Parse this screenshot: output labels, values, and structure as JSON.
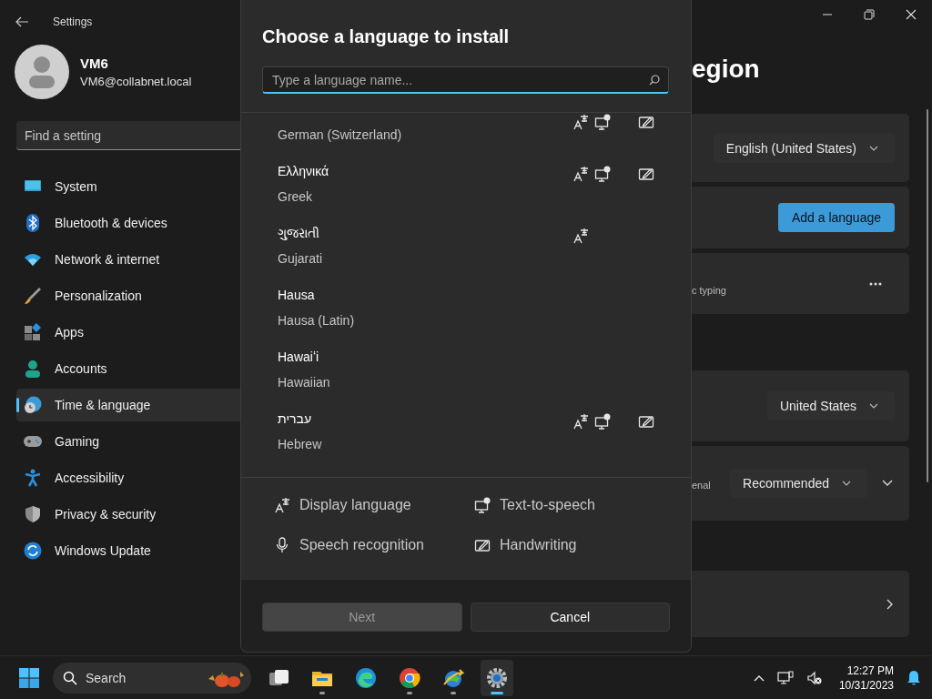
{
  "window": {
    "title": "Settings"
  },
  "sidebar": {
    "user": {
      "name": "VM6",
      "email": "VM6@collabnet.local"
    },
    "search": {
      "placeholder": "Find a setting"
    },
    "items": [
      {
        "label": "System",
        "kind": "system",
        "selected": false
      },
      {
        "label": "Bluetooth & devices",
        "kind": "bluetooth",
        "selected": false
      },
      {
        "label": "Network & internet",
        "kind": "network",
        "selected": false
      },
      {
        "label": "Personalization",
        "kind": "brush",
        "selected": false
      },
      {
        "label": "Apps",
        "kind": "apps",
        "selected": false
      },
      {
        "label": "Accounts",
        "kind": "accounts",
        "selected": false
      },
      {
        "label": "Time & language",
        "kind": "time",
        "selected": true
      },
      {
        "label": "Gaming",
        "kind": "gaming",
        "selected": false
      },
      {
        "label": "Accessibility",
        "kind": "accessibility",
        "selected": false
      },
      {
        "label": "Privacy & security",
        "kind": "privacy",
        "selected": false
      },
      {
        "label": "Windows Update",
        "kind": "update",
        "selected": false
      }
    ]
  },
  "page": {
    "heading": "egion",
    "cards": [
      {
        "kind": "dropdown",
        "value": "English (United States)",
        "expandable": false
      },
      {
        "kind": "button",
        "label": "Add a language"
      },
      {
        "kind": "more",
        "text": "c typing"
      },
      {
        "kind": "dropdown",
        "value": "United States",
        "expandable": false
      },
      {
        "kind": "dropdown",
        "text": "enal",
        "value": "Recommended",
        "expandable": true
      },
      {
        "kind": "link"
      }
    ]
  },
  "dialog": {
    "title": "Choose a language to install",
    "search": {
      "placeholder": "Type a language name..."
    },
    "languages": [
      {
        "english": "German (Switzerland)",
        "display": true,
        "tts": true,
        "speech": false,
        "handwriting": true
      },
      {
        "name": "Ελληνικά",
        "english": "Greek",
        "display": true,
        "tts": true,
        "speech": false,
        "handwriting": true
      },
      {
        "name": "ગુજરાતી",
        "english": "Gujarati",
        "display": true,
        "tts": false,
        "speech": false,
        "handwriting": false
      },
      {
        "name": "Hausa",
        "english": "Hausa (Latin)",
        "display": false,
        "tts": false,
        "speech": false,
        "handwriting": false
      },
      {
        "name": "Hawaiʻi",
        "english": "Hawaiian",
        "display": false,
        "tts": false,
        "speech": false,
        "handwriting": false
      },
      {
        "name": "עברית",
        "english": "Hebrew",
        "display": true,
        "tts": true,
        "speech": false,
        "handwriting": true
      }
    ],
    "legend": [
      {
        "kind": "display",
        "label": "Display language"
      },
      {
        "kind": "tts",
        "label": "Text-to-speech"
      },
      {
        "kind": "speech",
        "label": "Speech recognition"
      },
      {
        "kind": "handwriting",
        "label": "Handwriting"
      }
    ],
    "buttons": [
      {
        "label": "Next",
        "disabled": true
      },
      {
        "label": "Cancel",
        "disabled": false
      }
    ]
  },
  "taskbar": {
    "search": {
      "placeholder": "Search"
    },
    "apps": [
      {
        "kind": "taskview",
        "running": false,
        "active": false
      },
      {
        "kind": "explorer",
        "running": true,
        "active": false
      },
      {
        "kind": "edge",
        "running": false,
        "active": false
      },
      {
        "kind": "chrome",
        "running": true,
        "active": false
      },
      {
        "kind": "globe",
        "running": true,
        "active": false
      },
      {
        "kind": "settings",
        "running": true,
        "active": true
      }
    ],
    "time": "12:27 PM",
    "date": "10/31/2023"
  }
}
